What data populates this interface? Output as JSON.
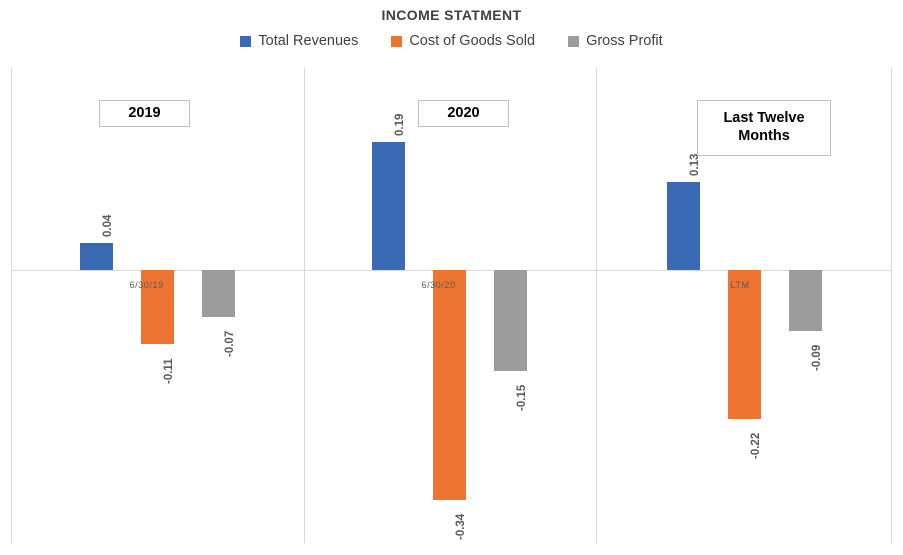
{
  "chart_data": {
    "type": "bar",
    "title": "INCOME STATMENT",
    "xlabel": "",
    "ylabel": "",
    "grid": false,
    "legend_position": "top-center",
    "ylim": [
      -0.38,
      0.22
    ],
    "categories": [
      "6/30/19",
      "6/30/20",
      "LTM"
    ],
    "group_titles": [
      "2019",
      "2020",
      "Last Twelve Months"
    ],
    "series": [
      {
        "name": "Total Revenues",
        "color": "#3A6AB5",
        "values": [
          0.04,
          0.19,
          0.13
        ]
      },
      {
        "name": "Cost of Goods Sold",
        "color": "#ED7431",
        "values": [
          -0.11,
          -0.34,
          -0.22
        ]
      },
      {
        "name": "Gross Profit",
        "color": "#9C9C9C",
        "values": [
          -0.07,
          -0.15,
          -0.09
        ]
      }
    ],
    "data_labels": [
      [
        "0.04",
        "0.19",
        "0.13"
      ],
      [
        "-0.11",
        "-0.34",
        "-0.22"
      ],
      [
        "-0.07",
        "-0.15",
        "-0.09"
      ]
    ]
  },
  "legend": {
    "items": [
      {
        "label": "Total Revenues"
      },
      {
        "label": "Cost of Goods Sold"
      },
      {
        "label": "Gross Profit"
      }
    ]
  },
  "axis": {
    "zero_line_color": "#D9D9D9",
    "border_color": "#D9D9D9"
  }
}
